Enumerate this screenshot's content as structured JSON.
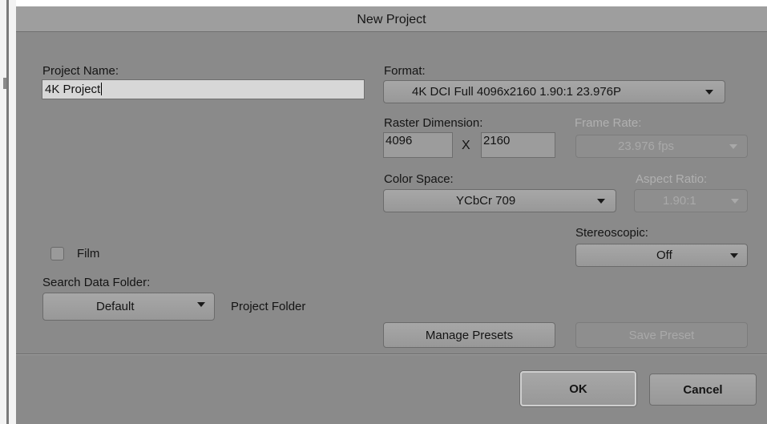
{
  "dialog": {
    "title": "New Project"
  },
  "project_name": {
    "label": "Project Name:",
    "value": "4K Project"
  },
  "format": {
    "label": "Format:",
    "selected": "4K DCI Full 4096x2160 1.90:1 23.976P"
  },
  "raster_dimension": {
    "label": "Raster Dimension:",
    "width": "4096",
    "separator": "X",
    "height": "2160"
  },
  "frame_rate": {
    "label": "Frame Rate:",
    "selected": "23.976 fps"
  },
  "color_space": {
    "label": "Color Space:",
    "selected": "YCbCr 709"
  },
  "aspect_ratio": {
    "label": "Aspect Ratio:",
    "selected": "1.90:1"
  },
  "stereoscopic": {
    "label": "Stereoscopic:",
    "selected": "Off"
  },
  "film": {
    "label": "Film",
    "checked": false
  },
  "search_data_folder": {
    "label": "Search Data Folder:",
    "selected": "Default",
    "path_label": "Project Folder"
  },
  "presets": {
    "manage_label": "Manage Presets",
    "save_label": "Save Preset"
  },
  "footer": {
    "ok_label": "OK",
    "cancel_label": "Cancel"
  }
}
